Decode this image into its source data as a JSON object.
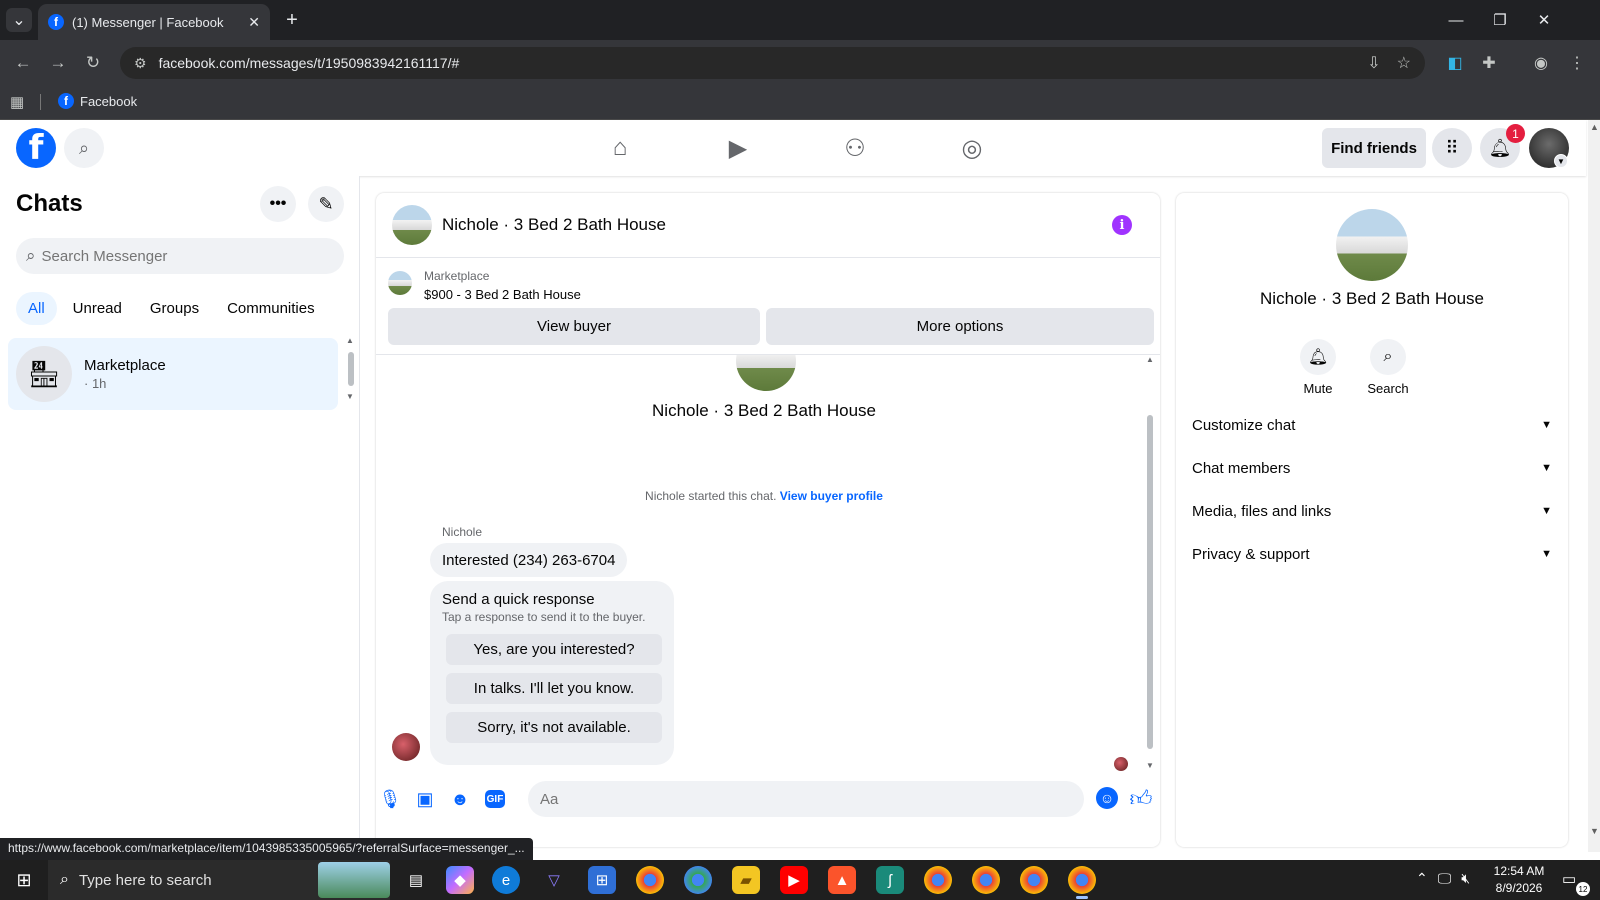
{
  "browser": {
    "tab_title": "(1) Messenger | Facebook",
    "url": "facebook.com/messages/t/1950983942161117/#",
    "bookmark": "Facebook"
  },
  "fbnav": {
    "logo": "f",
    "find_friends": "Find friends",
    "notification_count": "1"
  },
  "sidebar": {
    "title": "Chats",
    "search_placeholder": "Search Messenger",
    "filters": [
      "All",
      "Unread",
      "Groups",
      "Communities"
    ],
    "chat": {
      "name": "Marketplace",
      "time": "· 1h"
    }
  },
  "conversation": {
    "title": "Nichole · 3 Bed 2 Bath House",
    "marketplace_label": "Marketplace",
    "listing": "$900 - 3 Bed 2 Bath House",
    "view_buyer": "View buyer",
    "more_options": "More options",
    "thread_name": "Nichole · 3 Bed 2 Bath House",
    "started_text": "Nichole started this chat.",
    "buyer_profile_link": "View buyer profile",
    "sender": "Nichole",
    "message": "Interested (234) 263-6704",
    "quick_title": "Send a quick response",
    "quick_sub": "Tap a response to send it to the buyer.",
    "quick_responses": [
      "Yes, are you interested?",
      "In talks. I'll let you know.",
      "Sorry, it's not available."
    ],
    "composer_placeholder": "Aa",
    "gif_label": "GIF"
  },
  "right_panel": {
    "name": "Nichole · 3 Bed 2 Bath House",
    "actions": [
      "Mute",
      "Search"
    ],
    "sections": [
      "Customize chat",
      "Chat members",
      "Media, files and links",
      "Privacy & support"
    ]
  },
  "status_link": "https://www.facebook.com/marketplace/item/1043985335005965/?referralSurface=messenger_...",
  "taskbar": {
    "search_placeholder": "Type here to search",
    "time": "12:54 AM",
    "date": "8/9/2026",
    "notification_count": "12"
  },
  "colors": {
    "facebook_blue": "#0866ff",
    "active_chat_bg": "#ebf5ff",
    "info_purple": "#a033ff",
    "badge_red": "#e41e3f"
  }
}
